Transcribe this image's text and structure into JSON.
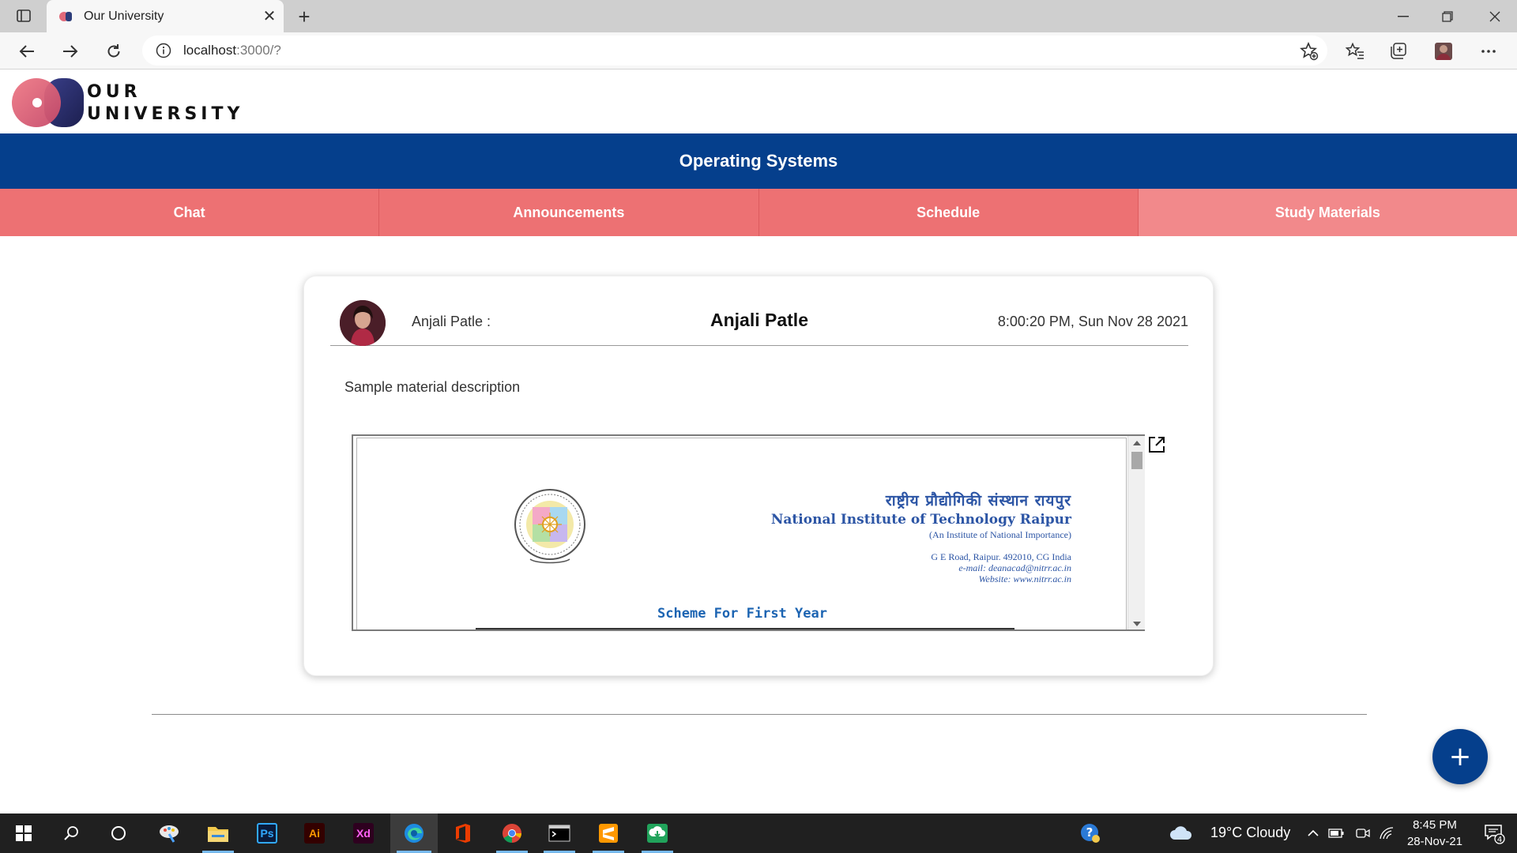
{
  "browser": {
    "tab_title": "Our University",
    "url_host": "localhost",
    "url_path": ":3000/?"
  },
  "logo": {
    "line1": "OUR",
    "line2": "UNIVERSITY"
  },
  "course": {
    "title": "Operating Systems"
  },
  "nav_tabs": [
    {
      "label": "Chat"
    },
    {
      "label": "Announcements"
    },
    {
      "label": "Schedule"
    },
    {
      "label": "Study Materials"
    }
  ],
  "active_tab": "Study Materials",
  "material": {
    "poster_label": "Anjali Patle :",
    "title": "Anjali Patle",
    "posted_at": "8:00:20 PM, Sun Nov 28 2021",
    "description": "Sample material description",
    "document": {
      "institute_hindi": "राष्ट्रीय प्रौद्योगिकी संस्थान रायपुर",
      "institute_name": "National Institute of Technology Raipur",
      "institute_tagline": "(An Institute of National Importance)",
      "address": "G E Road, Raipur. 492010, CG India",
      "email": "e-mail: deanacad@nitrr.ac.in",
      "website": "Website: www.nitrr.ac.in",
      "heading": "Scheme For First Year"
    }
  },
  "taskbar": {
    "weather": "19°C  Cloudy",
    "time": "8:45 PM",
    "date": "28-Nov-21",
    "notification_count": "4",
    "apps": [
      "Ps",
      "Ai",
      "Xd"
    ]
  },
  "colors": {
    "brand_blue": "#053f8c",
    "tab_coral": "#ed7173",
    "tab_active": "#f2898b",
    "doc_blue": "#2c55a5"
  }
}
